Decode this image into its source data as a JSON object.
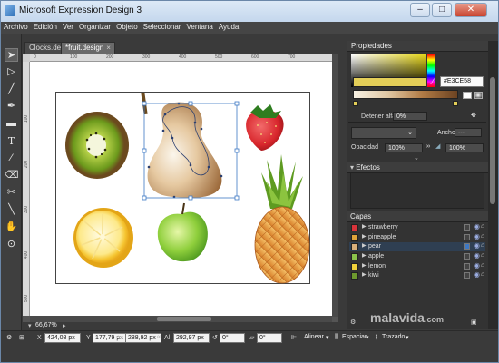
{
  "window": {
    "title": "Microsoft Expression Design 3"
  },
  "window_buttons": {
    "minimize": "–",
    "maximize": "□",
    "close": "✕"
  },
  "menu": [
    "Archivo",
    "Edición",
    "Ver",
    "Organizar",
    "Objeto",
    "Seleccionar",
    "Ventana",
    "Ayuda"
  ],
  "tabs": [
    {
      "label": "Clocks.design",
      "active": false
    },
    {
      "label": "*fruit.design",
      "active": true,
      "close": "×"
    }
  ],
  "rulers": {
    "horizontal": [
      "0",
      "100",
      "200",
      "300",
      "400",
      "500",
      "600",
      "700"
    ],
    "vertical": [
      "100",
      "200",
      "300",
      "400",
      "500"
    ]
  },
  "tools": [
    "selection-tool",
    "direct-selection-tool",
    "brush-tool",
    "pen-tool",
    "rectangle-tool",
    "text-tool",
    "eyedropper-tool",
    "eraser-tool",
    "scissors-tool",
    "gradient-tool",
    "pan-tool",
    "zoom-tool"
  ],
  "artboard": {
    "fruits": [
      "kiwi",
      "pear",
      "strawberry",
      "lemon",
      "apple",
      "pineapple"
    ]
  },
  "zoom": {
    "value": "66,67%"
  },
  "status": {
    "x_label": "X",
    "x_value": "424,08 px",
    "y_label": "Y",
    "y_value": "177,79 px",
    "w_label": "An",
    "w_value": "288,92 px",
    "h_label": "Al",
    "h_value": "292,97 px",
    "rotation_value": "0°",
    "skew_value": "0°",
    "align_label": "Alinear",
    "space_label": "Espaciar",
    "path_label": "Trazado"
  },
  "properties": {
    "header": "Propiedades",
    "hex": "#E3CE58",
    "stroke_stop_label": "Detener alfa",
    "stroke_stop_value": "0%",
    "width_label": "Ancho",
    "width_value": "---",
    "opacity_label": "Opacidad",
    "opacity_value": "100%",
    "opacity2_value": "100%"
  },
  "effects": {
    "header": "Efectos"
  },
  "layers": {
    "header": "Capas",
    "items": [
      {
        "name": "strawberry",
        "thumb": "#d8333a",
        "selected": false
      },
      {
        "name": "pineapple",
        "thumb": "#e0a43a",
        "selected": false
      },
      {
        "name": "pear",
        "thumb": "#d9b07a",
        "selected": true
      },
      {
        "name": "apple",
        "thumb": "#8bc34a",
        "selected": false
      },
      {
        "name": "lemon",
        "thumb": "#f1d23a",
        "selected": false
      },
      {
        "name": "kiwi",
        "thumb": "#6e9a2e",
        "selected": false
      }
    ]
  },
  "watermark": {
    "brand": "malavida",
    "domain": ".com"
  },
  "colors": {
    "accent": "#E3CE58",
    "selection": "#3d78c4",
    "panel_bg": "#333333"
  }
}
